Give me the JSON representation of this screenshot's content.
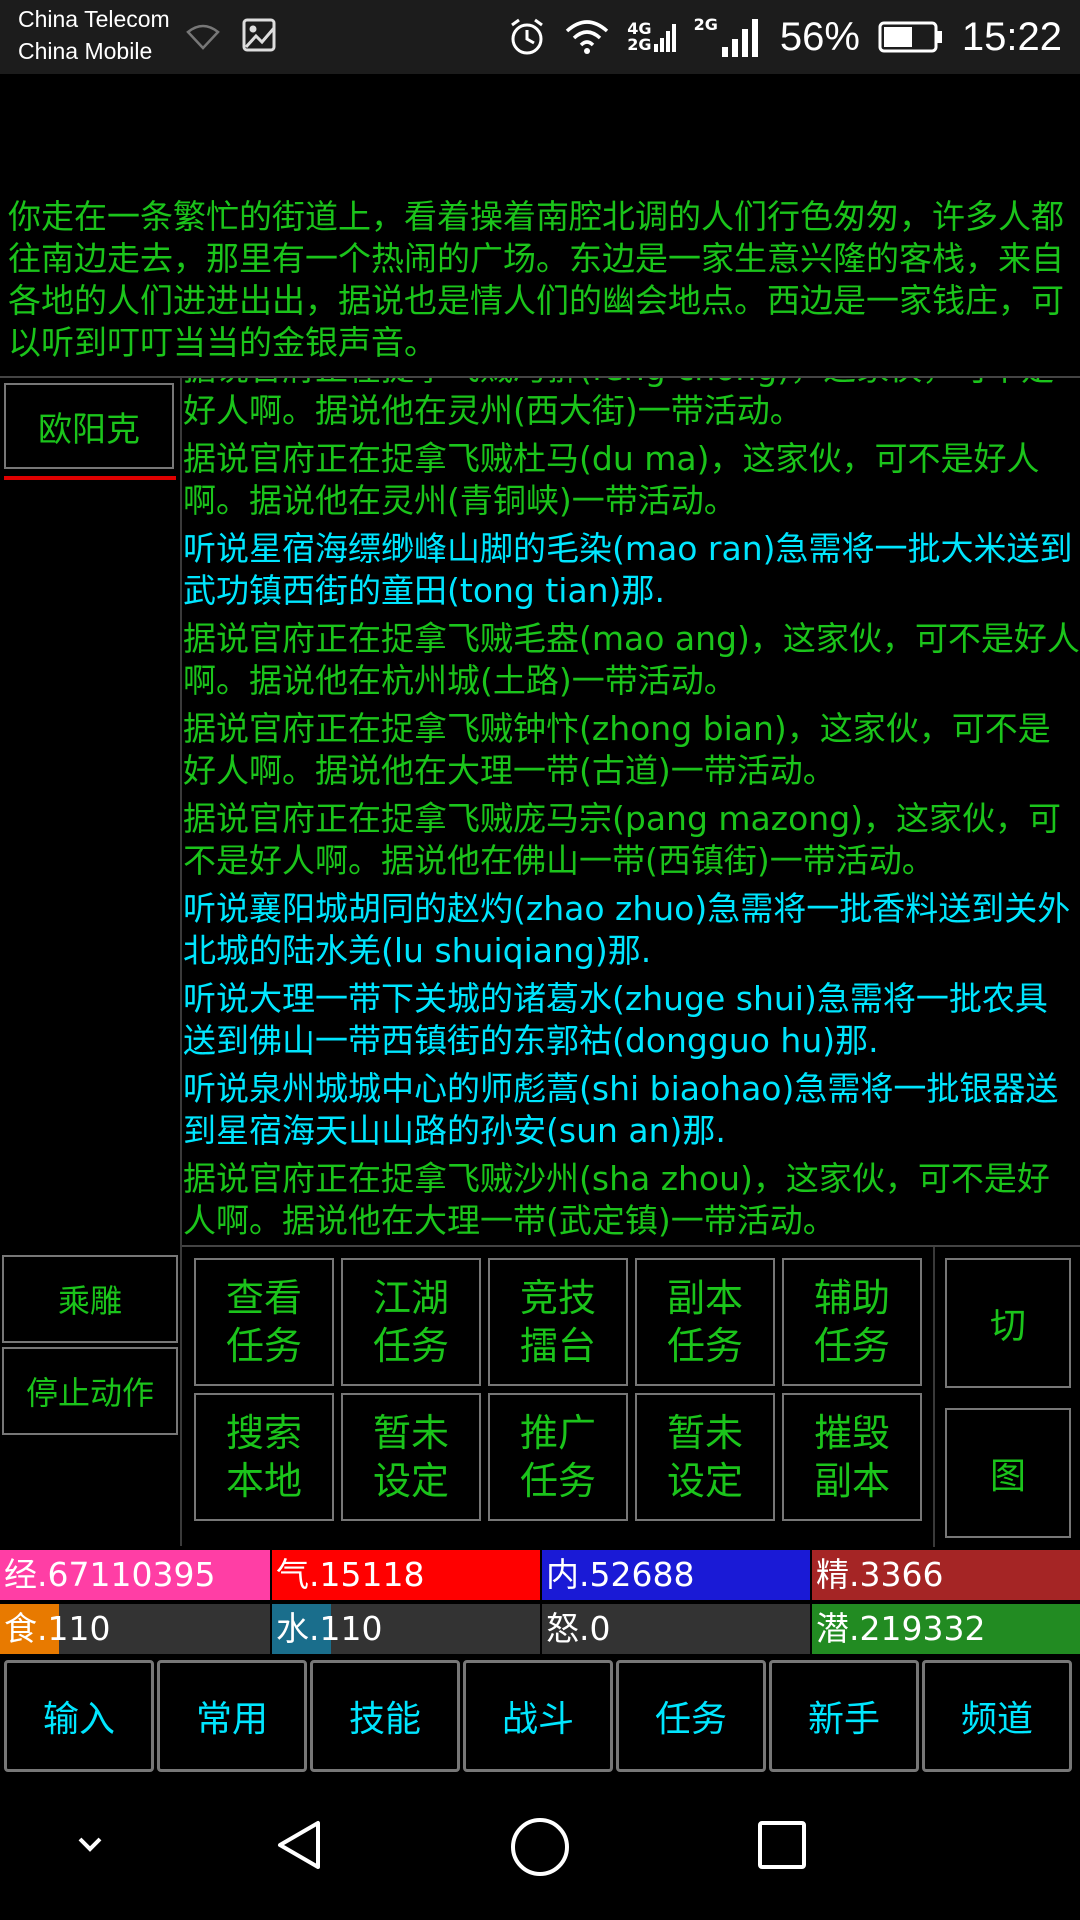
{
  "status_bar": {
    "carrier1": "China Telecom",
    "carrier2": "China Mobile",
    "net1": "4G",
    "net2": "2G",
    "net3": "2G",
    "battery": "56%",
    "time": "15:22"
  },
  "room_description": "你走在一条繁忙的街道上，看着操着南腔北调的人们行色匆匆，许多人都往南边走去，那里有一个热闹的广场。东边是一家生意兴隆的客栈，来自各地的人们进进出出，据说也是情人们的幽会地点。西边是一家钱庄，可以听到叮叮当当的金银声音。",
  "npc": {
    "name": "欧阳克"
  },
  "side_buttons": {
    "ride": "乘雕",
    "stop": "停止动作"
  },
  "messages": [
    {
      "type": "rumor",
      "text": "据说官府正在捉拿飞贼冯翀(feng chong)，这家伙，可不是好人啊。据说他在灵州(西大街)一带活动。"
    },
    {
      "type": "rumor",
      "text": "据说官府正在捉拿飞贼杜马(du ma)，这家伙，可不是好人啊。据说他在灵州(青铜峡)一带活动。"
    },
    {
      "type": "quest",
      "text": "听说星宿海缥缈峰山脚的毛染(mao ran)急需将一批大米送到武功镇西街的童田(tong tian)那."
    },
    {
      "type": "rumor",
      "text": "据说官府正在捉拿飞贼毛盎(mao ang)，这家伙，可不是好人啊。据说他在杭州城(土路)一带活动。"
    },
    {
      "type": "rumor",
      "text": "据说官府正在捉拿飞贼钟忭(zhong bian)，这家伙，可不是好人啊。据说他在大理一带(古道)一带活动。"
    },
    {
      "type": "rumor",
      "text": "据说官府正在捉拿飞贼庞马宗(pang mazong)，这家伙，可不是好人啊。据说他在佛山一带(西镇街)一带活动。"
    },
    {
      "type": "quest",
      "text": "听说襄阳城胡同的赵灼(zhao zhuo)急需将一批香料送到关外北城的陆水羌(lu shuiqiang)那."
    },
    {
      "type": "quest",
      "text": "听说大理一带下关城的诸葛水(zhuge shui)急需将一批农具送到佛山一带西镇街的东郭祜(dongguo hu)那."
    },
    {
      "type": "quest",
      "text": "听说泉州城城中心的师彪蒿(shi biaohao)急需将一批银器送到星宿海天山山路的孙安(sun an)那."
    },
    {
      "type": "rumor",
      "text": "据说官府正在捉拿飞贼沙州(sha zhou)，这家伙，可不是好人啊。据说他在大理一带(武定镇)一带活动。"
    }
  ],
  "actions": [
    "查看任务",
    "江湖任务",
    "竞技擂台",
    "副本任务",
    "辅助任务",
    "搜索本地",
    "暂未设定",
    "推广任务",
    "暂未设定",
    "摧毁副本"
  ],
  "right_buttons": {
    "switch": "切",
    "map": "图"
  },
  "stats": [
    {
      "label": "经.67110395",
      "fill": 1.0,
      "color": "#ff3ea5"
    },
    {
      "label": "气.15118",
      "fill": 1.0,
      "color": "#ff0000"
    },
    {
      "label": "内.52688",
      "fill": 1.0,
      "color": "#1a1ad6"
    },
    {
      "label": "精.3366",
      "fill": 1.0,
      "color": "#a52525"
    },
    {
      "label": "食.110",
      "fill": 0.22,
      "color": "#e87a00"
    },
    {
      "label": "水.110",
      "fill": 0.22,
      "color": "#1a6e8c"
    },
    {
      "label": "怒.0",
      "fill": 0.0,
      "color": "#333333"
    },
    {
      "label": "潜.219332",
      "fill": 1.0,
      "color": "#228b22"
    }
  ],
  "stat_track_color": "#333333",
  "tabs": [
    "输入",
    "常用",
    "技能",
    "战斗",
    "任务",
    "新手",
    "频道"
  ],
  "nav_icons": [
    "chevron-down-icon",
    "back-icon",
    "home-icon",
    "recents-icon"
  ]
}
